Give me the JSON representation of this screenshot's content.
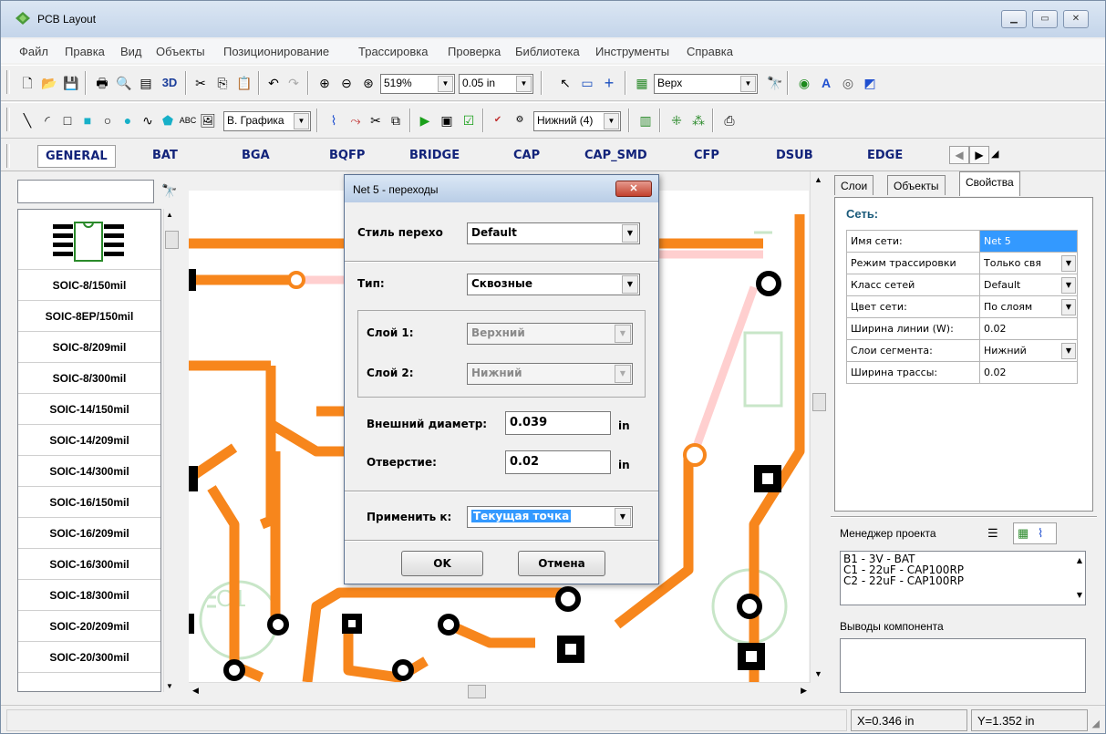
{
  "window": {
    "title": "PCB Layout"
  },
  "menu": [
    "Файл",
    "Правка",
    "Вид",
    "Объекты",
    "Позиционирование",
    "Трассировка",
    "Проверка",
    "Библиотека",
    "Инструменты",
    "Справка"
  ],
  "toolbar1": {
    "zoom": "519%",
    "grid": "0.05 in",
    "layer": "Верх"
  },
  "toolbar2": {
    "graphics_layer": "В. Графика",
    "route_layer": "Нижний (4)",
    "text_tool": "ABC"
  },
  "library_tabs": {
    "active": "GENERAL",
    "items": [
      "BAT",
      "BGA",
      "BQFP",
      "BRIDGE",
      "CAP",
      "CAP_SMD",
      "CFP",
      "DSUB",
      "EDGE"
    ]
  },
  "components": [
    "SOIC-8/150mil",
    "SOIC-8EP/150mil",
    "SOIC-8/209mil",
    "SOIC-8/300mil",
    "SOIC-14/150mil",
    "SOIC-14/209mil",
    "SOIC-14/300mil",
    "SOIC-16/150mil",
    "SOIC-16/209mil",
    "SOIC-16/300mil",
    "SOIC-18/300mil",
    "SOIC-20/209mil",
    "SOIC-20/300mil"
  ],
  "right_tabs": [
    "Слои",
    "Объекты",
    "Свойства"
  ],
  "properties": {
    "section": "Сеть:",
    "rows": [
      {
        "label": "Имя сети:",
        "value": "Net 5"
      },
      {
        "label": "Режим трассировки",
        "value": "Только свя"
      },
      {
        "label": "Класс сетей",
        "value": "Default"
      },
      {
        "label": "Цвет сети:",
        "value": "По слоям"
      },
      {
        "label": "Ширина линии (W):",
        "value": "0.02"
      },
      {
        "label": "Слои сегмента:",
        "value": "Нижний"
      },
      {
        "label": "Ширина трассы:",
        "value": "0.02"
      }
    ]
  },
  "project_manager": {
    "title": "Менеджер проекта",
    "items": [
      "B1 - 3V - BAT",
      "C1 - 22uF - CAP100RP",
      "C2 - 22uF - CAP100RP"
    ]
  },
  "pins": {
    "title": "Выводы компонента"
  },
  "dialog": {
    "title": "Net 5 - переходы",
    "style_label": "Стиль перехо",
    "style_value": "Default",
    "type_label": "Тип:",
    "type_value": "Сквозные",
    "layer1_label": "Слой 1:",
    "layer1_value": "Верхний",
    "layer2_label": "Слой 2:",
    "layer2_value": "Нижний",
    "outer_label": "Внешний диаметр:",
    "outer_value": "0.039",
    "hole_label": "Отверстие:",
    "hole_value": "0.02",
    "unit": "in",
    "apply_label": "Применить к:",
    "apply_value": "Текущая точка",
    "ok": "OK",
    "cancel": "Отмена"
  },
  "status": {
    "x": "X=0.346 in",
    "y": "Y=1.352 in"
  },
  "canvas_labels": {
    "c1": "C1"
  },
  "colors": {
    "trace": "#f7861c",
    "ratsnest": "#ffcfcf",
    "silk": "#c8e6c8"
  }
}
